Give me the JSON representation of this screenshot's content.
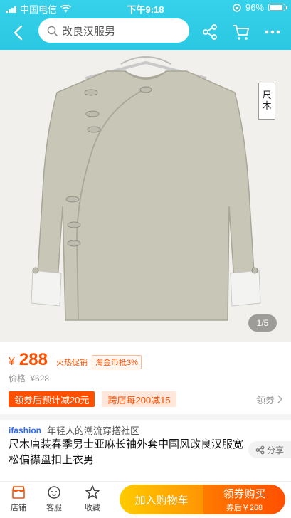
{
  "status_bar": {
    "carrier": "中国电信",
    "time": "下午9:18",
    "battery": "96%"
  },
  "nav": {
    "search_text": "改良汉服男"
  },
  "gallery": {
    "pager": "1/5",
    "brand_tag_line1": "尺",
    "brand_tag_line2": "木"
  },
  "price": {
    "currency": "¥",
    "value": "288",
    "promo": "火热促销",
    "coin_deal": "淘金币抵3%",
    "original_label": "价格",
    "original_value": "¥628"
  },
  "coupons": {
    "after_coupon": "领券后预计减20元",
    "cross_store": "跨店每200减15",
    "more_label": "领券"
  },
  "ifashion": {
    "logo": "ifashion",
    "desc": "年轻人的潮流穿搭社区"
  },
  "product": {
    "title": "尺木唐装春季男士亚麻长袖外套中国风改良汉服宽松偏襟盘扣上衣男",
    "share_label": "分享"
  },
  "bottom_bar": {
    "store_label": "店铺",
    "service_label": "客服",
    "favorite_label": "收藏",
    "add_cart_label": "加入购物车",
    "buy_label": "领券购买",
    "buy_sub": "券后￥268"
  },
  "colors": {
    "accent": "#ff4f00",
    "header": "#2bc8e3",
    "cart_button": "#ffb000"
  }
}
